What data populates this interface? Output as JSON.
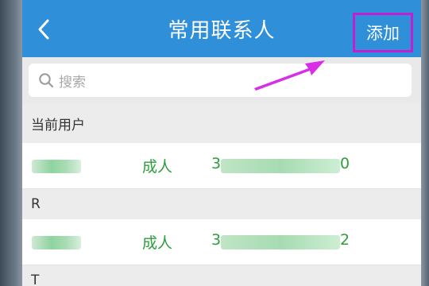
{
  "header": {
    "back_icon": "chevron-left-icon",
    "title": "常用联系人",
    "add_label": "添加"
  },
  "colors": {
    "header_bg": "#2f8fd8",
    "highlight": "#c21fd3",
    "accent_green": "#2e9e3c"
  },
  "search": {
    "icon": "search-icon",
    "placeholder": "搜索"
  },
  "sections": [
    {
      "label": "当前用户",
      "contacts": [
        {
          "name": "",
          "type": "成人",
          "phone_start": "3",
          "phone_end": "0"
        }
      ]
    },
    {
      "label": "R",
      "contacts": [
        {
          "name": "",
          "type": "成人",
          "phone_start": "3",
          "phone_end": "2"
        }
      ]
    },
    {
      "label": "T",
      "contacts": []
    }
  ]
}
